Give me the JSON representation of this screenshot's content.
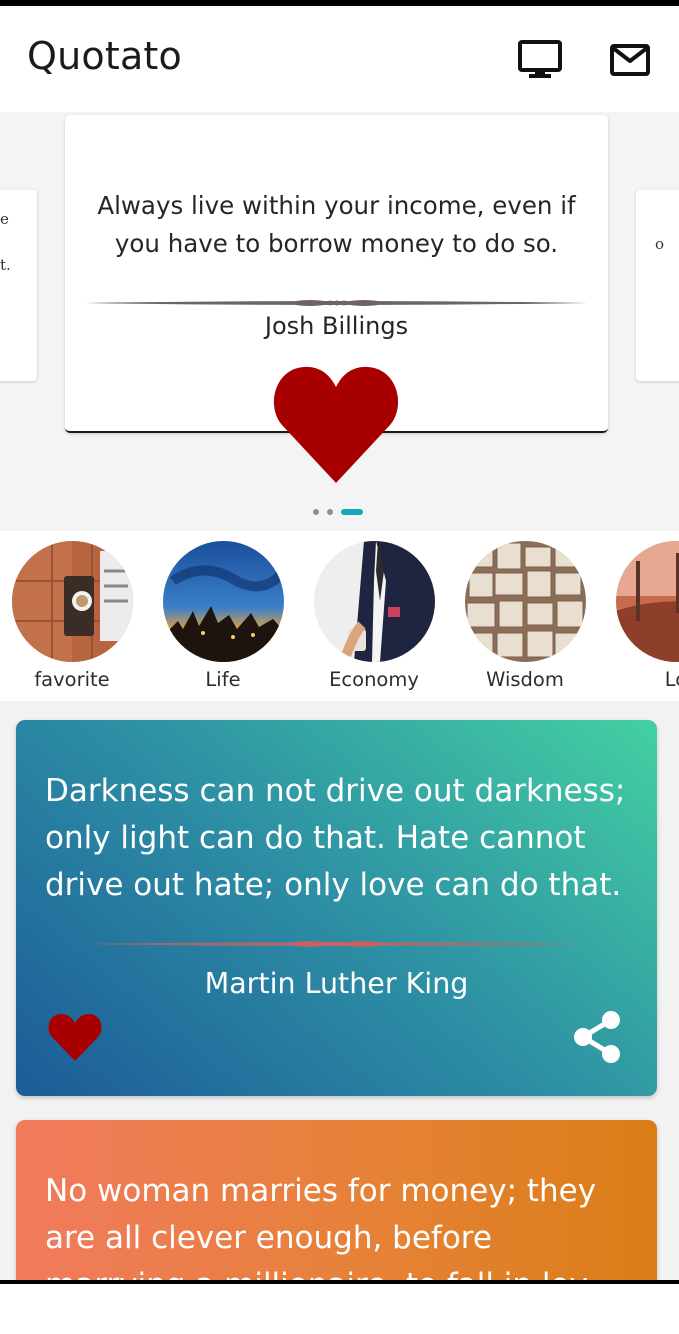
{
  "app": {
    "title": "Quotato"
  },
  "appbar": {
    "icons": [
      "monitor-icon",
      "mail-icon"
    ]
  },
  "featured": {
    "quote": "Always live within your income, even if you have to borrow money to do so.",
    "author": "Josh Billings",
    "prev_fragment": [
      "e",
      "t."
    ],
    "next_fragment": "o",
    "heart_color": "#a80000",
    "pager": {
      "count": 3,
      "active_index": 3
    }
  },
  "categories": [
    {
      "label": "favorite"
    },
    {
      "label": "Life"
    },
    {
      "label": "Economy"
    },
    {
      "label": "Wisdom"
    },
    {
      "label": "Lo"
    }
  ],
  "quotes": [
    {
      "text": "Darkness can not drive out darkness; only light can do that. Hate cannot drive out hate; only love can do that.",
      "author": "Martin Luther King",
      "gradient": [
        "#1c5b98",
        "#44d0a2"
      ]
    },
    {
      "text": "No woman marries for money; they are all clever enough, before marrying a millionaire, to fall in lov",
      "gradient": [
        "#f17a5e",
        "#da7d16"
      ]
    }
  ],
  "colors": {
    "accent": "#16a6c4",
    "heart": "#a80000",
    "pager_inactive": "#8c8c8c"
  }
}
